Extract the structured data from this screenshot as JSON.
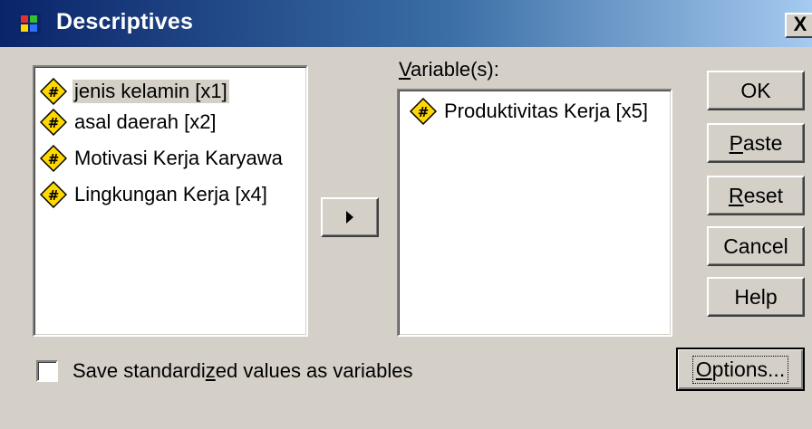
{
  "window": {
    "title": "Descriptives",
    "close_glyph": "X"
  },
  "source_list": {
    "items": [
      {
        "label": "jenis kelamin [x1]",
        "icon": "variable-scale-icon",
        "selected": true
      },
      {
        "label": "asal daerah [x2]",
        "icon": "variable-scale-icon",
        "selected": false
      },
      {
        "label": "Motivasi Kerja Karyawa",
        "icon": "variable-scale-icon",
        "selected": false
      },
      {
        "label": "Lingkungan Kerja [x4]",
        "icon": "variable-scale-icon",
        "selected": false
      }
    ]
  },
  "move_button": {
    "icon": "right-arrow-icon"
  },
  "variables": {
    "label_first": "V",
    "label_rest": "ariable(s):",
    "items": [
      {
        "label": "Produktivitas Kerja [x5]",
        "icon": "variable-scale-icon"
      }
    ]
  },
  "buttons": {
    "ok": "OK",
    "paste_key": "P",
    "paste_rest": "aste",
    "reset_key": "R",
    "reset_rest": "eset",
    "cancel": "Cancel",
    "help": "Help",
    "options_key": "O",
    "options_rest": "ptions..."
  },
  "save_standardized": {
    "checked": false,
    "label_pre": "Save standardi",
    "label_key": "z",
    "label_post": "ed values as variables"
  },
  "colors": {
    "dialog_bg": "#d4d0c8",
    "title_gradient_start": "#0a246a",
    "title_gradient_end": "#a6caf0",
    "icon_yellow": "#ffd800"
  }
}
